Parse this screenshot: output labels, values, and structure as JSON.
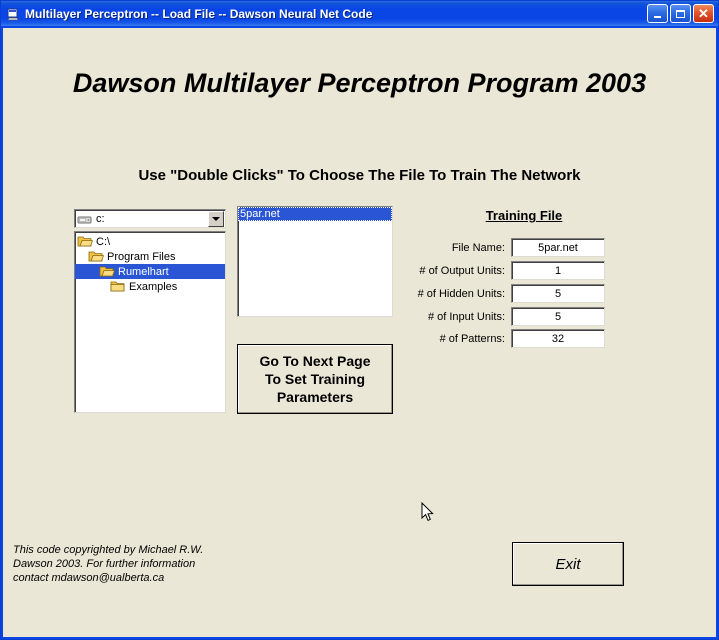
{
  "window": {
    "title": "Multilayer Perceptron -- Load File -- Dawson Neural Net Code",
    "icon": "app-icon",
    "buttons": {
      "minimize": "_",
      "maximize": "□",
      "close": "✕"
    },
    "colors": {
      "titlebar": "#0a46e6",
      "client_background": "#ebe7d7",
      "selection": "#2a56d6",
      "close_button": "#e2542a"
    }
  },
  "main": {
    "heading": "Dawson Multilayer Perceptron Program 2003",
    "instruction": "Use \"Double Clicks\" To Choose The File To Train The Network"
  },
  "drive_combo": {
    "value": "c:",
    "icon": "drive-icon",
    "arrow_icon": "chevron-down-icon"
  },
  "dir_tree": {
    "items": [
      {
        "label": "C:\\",
        "indent": 0,
        "selected": false,
        "icon": "folder-open-icon"
      },
      {
        "label": "Program Files",
        "indent": 1,
        "selected": false,
        "icon": "folder-open-icon"
      },
      {
        "label": "Rumelhart",
        "indent": 2,
        "selected": true,
        "icon": "folder-open-icon"
      },
      {
        "label": "Examples",
        "indent": 3,
        "selected": false,
        "icon": "folder-closed-icon"
      }
    ]
  },
  "file_list": {
    "items": [
      {
        "label": "5par.net",
        "selected": true
      }
    ]
  },
  "next_page_button": {
    "line1": "Go To Next Page",
    "line2": "To Set Training",
    "line3": "Parameters"
  },
  "training_file": {
    "title": "Training File",
    "fields": [
      {
        "label": "File Name:",
        "value": "5par.net"
      },
      {
        "label": "# of Output Units:",
        "value": "1"
      },
      {
        "label": "# of Hidden Units:",
        "value": "5"
      },
      {
        "label": "# of Input Units:",
        "value": "5"
      },
      {
        "label": "# of Patterns:",
        "value": "32"
      }
    ]
  },
  "exit_button": {
    "label": "Exit"
  },
  "copyright": {
    "text": "This code copyrighted by Michael R.W.\nDawson 2003.  For further  information\ncontact mdawson@ualberta.ca"
  }
}
